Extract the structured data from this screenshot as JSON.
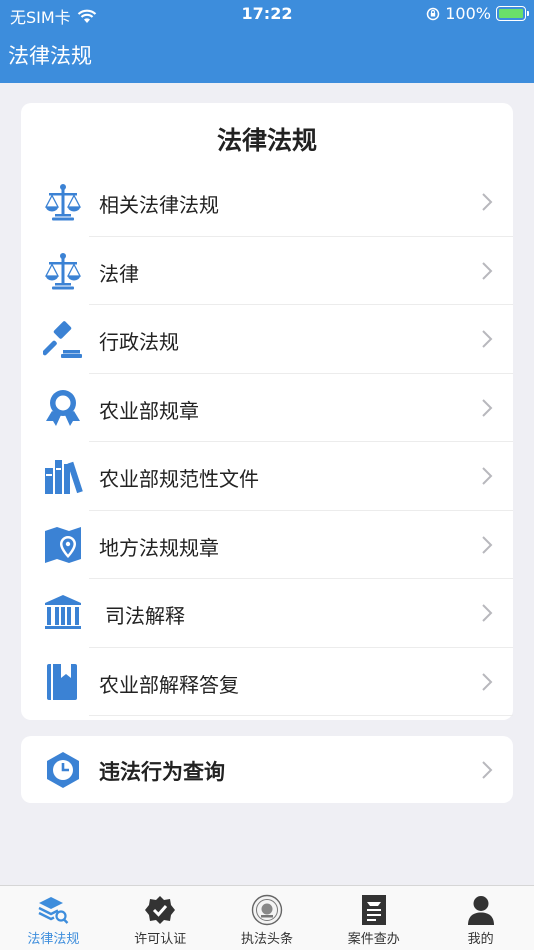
{
  "status_bar": {
    "carrier": "无SIM卡",
    "time": "17:22",
    "battery": "100%"
  },
  "nav": {
    "title": "法律法规"
  },
  "main_card": {
    "title": "法律法规",
    "items": [
      {
        "label": "相关法律法规",
        "icon": "scales-icon"
      },
      {
        "label": "法律",
        "icon": "scales-icon"
      },
      {
        "label": "行政法规",
        "icon": "gavel-icon"
      },
      {
        "label": "农业部规章",
        "icon": "award-ribbon-icon"
      },
      {
        "label": "农业部规范性文件",
        "icon": "books-icon"
      },
      {
        "label": "地方法规规章",
        "icon": "map-pin-icon"
      },
      {
        "label": "司法解释",
        "icon": "courthouse-icon"
      },
      {
        "label": "农业部解释答复",
        "icon": "bookmark-book-icon"
      }
    ]
  },
  "query_card": {
    "label": "违法行为查询",
    "icon": "clock-hexagon-icon"
  },
  "tabbar": {
    "tabs": [
      {
        "label": "法律法规",
        "icon": "layers-search-icon",
        "active": true
      },
      {
        "label": "许可认证",
        "icon": "verified-badge-icon",
        "active": false
      },
      {
        "label": "执法头条",
        "icon": "emblem-seal-icon",
        "active": false
      },
      {
        "label": "案件查办",
        "icon": "document-icon",
        "active": false
      },
      {
        "label": "我的",
        "icon": "person-icon",
        "active": false
      }
    ]
  },
  "colors": {
    "primary": "#3d8ddc",
    "icon_blue": "#3b82d4",
    "background": "#efeff4"
  }
}
